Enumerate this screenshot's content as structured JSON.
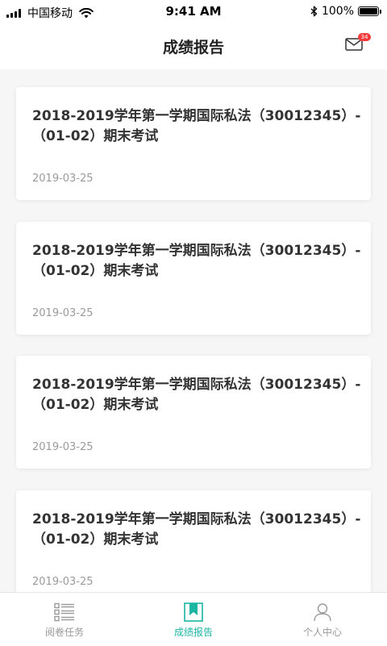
{
  "status_bar": {
    "carrier": "中国移动",
    "time": "9:41 AM",
    "battery": "100%"
  },
  "header": {
    "title": "成绩报告",
    "mail_badge": "34"
  },
  "colors": {
    "accent": "#1bb5a4",
    "badge": "#f23b3b"
  },
  "reports": [
    {
      "title": "2018-2019学年第一学期国际私法（30012345）-（01-02）期末考试",
      "date": "2019-03-25"
    },
    {
      "title": "2018-2019学年第一学期国际私法（30012345）-（01-02）期末考试",
      "date": "2019-03-25"
    },
    {
      "title": "2018-2019学年第一学期国际私法（30012345）-（01-02）期末考试",
      "date": "2019-03-25"
    },
    {
      "title": "2018-2019学年第一学期国际私法（30012345）-（01-02）期末考试",
      "date": "2019-03-25"
    }
  ],
  "tabs": [
    {
      "label": "阅卷任务",
      "icon": "list-icon",
      "active": false
    },
    {
      "label": "成绩报告",
      "icon": "bookmark-icon",
      "active": true
    },
    {
      "label": "个人中心",
      "icon": "user-icon",
      "active": false
    }
  ]
}
